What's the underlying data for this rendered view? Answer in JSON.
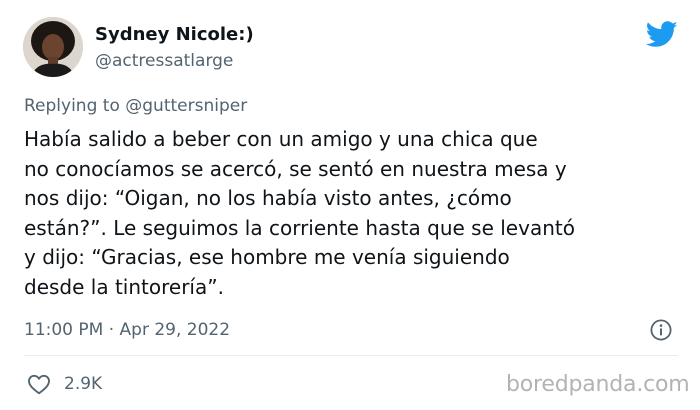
{
  "author": {
    "name": "Sydney Nicole:)",
    "handle": "@actressatlarge"
  },
  "reply": {
    "prefix": "Replying to ",
    "handle": "@guttersniper"
  },
  "tweet": {
    "text": "Había salido a beber con un amigo y una chica que\nno conocíamos se acercó, se sentó en nuestra mesa y\nnos dijo: “Oigan, no los había visto antes, ¿cómo\nestán?”. Le seguimos la corriente hasta que se levantó\ny dijo: “Gracias, ese hombre me venía siguiendo\ndesde la tintorería”.",
    "timestamp": "11:00 PM · Apr 29, 2022"
  },
  "stats": {
    "likes": "2.9K"
  },
  "watermark": "boredpanda.com",
  "icons": {
    "brand": "twitter-bird-icon",
    "info": "info-icon",
    "like": "heart-icon"
  },
  "colors": {
    "twitter_blue": "#1d9bf0",
    "secondary_text": "#536471",
    "primary_text": "#0f1419"
  }
}
